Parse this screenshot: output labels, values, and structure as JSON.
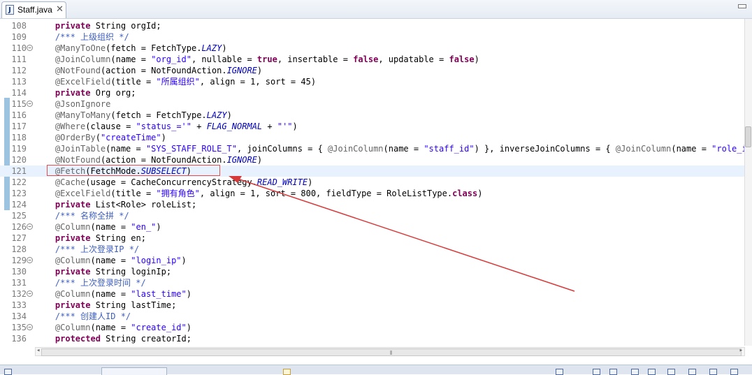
{
  "tab": {
    "title": "Staff.java",
    "close_glyph": "✕",
    "icon": "java-file-icon"
  },
  "code_lines": [
    {
      "num": "108",
      "fold": false,
      "html": "    <span class='kw'>private</span> String orgId;"
    },
    {
      "num": "109",
      "fold": false,
      "html": "    <span class='cmt'>/*** 上级组织 */</span>"
    },
    {
      "num": "110",
      "fold": true,
      "html": "    <span class='ann'>@ManyToOne</span>(fetch = FetchType.<span class='ital'>LAZY</span>)"
    },
    {
      "num": "111",
      "fold": false,
      "html": "    <span class='ann'>@JoinColumn</span>(name = <span class='str'>\"org_id\"</span>, nullable = <span class='kw'>true</span>, insertable = <span class='kw'>false</span>, updatable = <span class='kw'>false</span>)"
    },
    {
      "num": "112",
      "fold": false,
      "html": "    <span class='ann'>@NotFound</span>(action = NotFoundAction.<span class='ital'>IGNORE</span>)"
    },
    {
      "num": "113",
      "fold": false,
      "html": "    <span class='ann'>@ExcelField</span>(title = <span class='str'>\"所属组织\"</span>, align = 1, sort = 45)"
    },
    {
      "num": "114",
      "fold": false,
      "html": "    <span class='kw'>private</span> Org org;"
    },
    {
      "num": "115",
      "fold": true,
      "html": "    <span class='ann'>@JsonIgnore</span>"
    },
    {
      "num": "116",
      "fold": false,
      "html": "    <span class='ann'>@ManyToMany</span>(fetch = FetchType.<span class='ital'>LAZY</span>)"
    },
    {
      "num": "117",
      "fold": false,
      "html": "    <span class='ann'>@Where</span>(clause = <span class='str'>\"status_='\"</span> + <span class='ital'>FLAG_NORMAL</span> + <span class='str'>\"'\"</span>)"
    },
    {
      "num": "118",
      "fold": false,
      "html": "    <span class='ann'>@OrderBy</span>(<span class='str'>\"createTime\"</span>)"
    },
    {
      "num": "119",
      "fold": false,
      "html": "    <span class='ann'>@JoinTable</span>(name = <span class='str'>\"SYS_STAFF_ROLE_T\"</span>, joinColumns = { <span class='ann'>@JoinColumn</span>(name = <span class='str'>\"staff_id\"</span>) }, inverseJoinColumns = { <span class='ann'>@JoinColumn</span>(name = <span class='str'>\"role_id\"</span>) }"
    },
    {
      "num": "120",
      "fold": false,
      "html": "    <span class='ann'>@NotFound</span>(action = NotFoundAction.<span class='ital'>IGNORE</span>)"
    },
    {
      "num": "121",
      "fold": false,
      "cur": true,
      "html": "    <span class='ann'>@Fetch</span>(FetchMode.<span class='ital'>SUBSELECT</span>)"
    },
    {
      "num": "122",
      "fold": false,
      "html": "    <span class='ann'>@Cache</span>(usage = CacheConcurrencyStrategy.<span class='ital'>READ_WRITE</span>)"
    },
    {
      "num": "123",
      "fold": false,
      "html": "    <span class='ann'>@ExcelField</span>(title = <span class='str'>\"拥有角色\"</span>, align = 1, sort = 800, fieldType = RoleListType.<span class='kw'>class</span>)"
    },
    {
      "num": "124",
      "fold": false,
      "html": "    <span class='kw'>private</span> List&lt;Role&gt; roleList;"
    },
    {
      "num": "125",
      "fold": false,
      "html": "    <span class='cmt'>/*** 名称全拼 */</span>"
    },
    {
      "num": "126",
      "fold": true,
      "html": "    <span class='ann'>@Column</span>(name = <span class='str'>\"en_\"</span>)"
    },
    {
      "num": "127",
      "fold": false,
      "html": "    <span class='kw'>private</span> String en;"
    },
    {
      "num": "128",
      "fold": false,
      "html": "    <span class='cmt'>/*** 上次登录IP */</span>"
    },
    {
      "num": "129",
      "fold": true,
      "html": "    <span class='ann'>@Column</span>(name = <span class='str'>\"login_ip\"</span>)"
    },
    {
      "num": "130",
      "fold": false,
      "html": "    <span class='kw'>private</span> String loginIp;"
    },
    {
      "num": "131",
      "fold": false,
      "html": "    <span class='cmt'>/*** 上次登录时间 */</span>"
    },
    {
      "num": "132",
      "fold": true,
      "html": "    <span class='ann'>@Column</span>(name = <span class='str'>\"last_time\"</span>)"
    },
    {
      "num": "133",
      "fold": false,
      "html": "    <span class='kw'>private</span> String lastTime;"
    },
    {
      "num": "134",
      "fold": false,
      "html": "    <span class='cmt'>/*** 创建人ID */</span>"
    },
    {
      "num": "135",
      "fold": true,
      "html": "    <span class='ann'>@Column</span>(name = <span class='str'>\"create_id\"</span>)"
    },
    {
      "num": "136",
      "fold": false,
      "html": "    <span class='kw'>protected</span> String creatorId;"
    }
  ],
  "highlighted_line": "121",
  "colors": {
    "keyword": "#7f0055",
    "annotation": "#646464",
    "string": "#2a00ff",
    "comment": "#3f5fbf",
    "constant": "#0000c0",
    "current_line": "#e8f2fe",
    "annotation_box": "#e05050",
    "arrow": "#d63a3a"
  },
  "scrollbar": {
    "grip": "⦀"
  }
}
